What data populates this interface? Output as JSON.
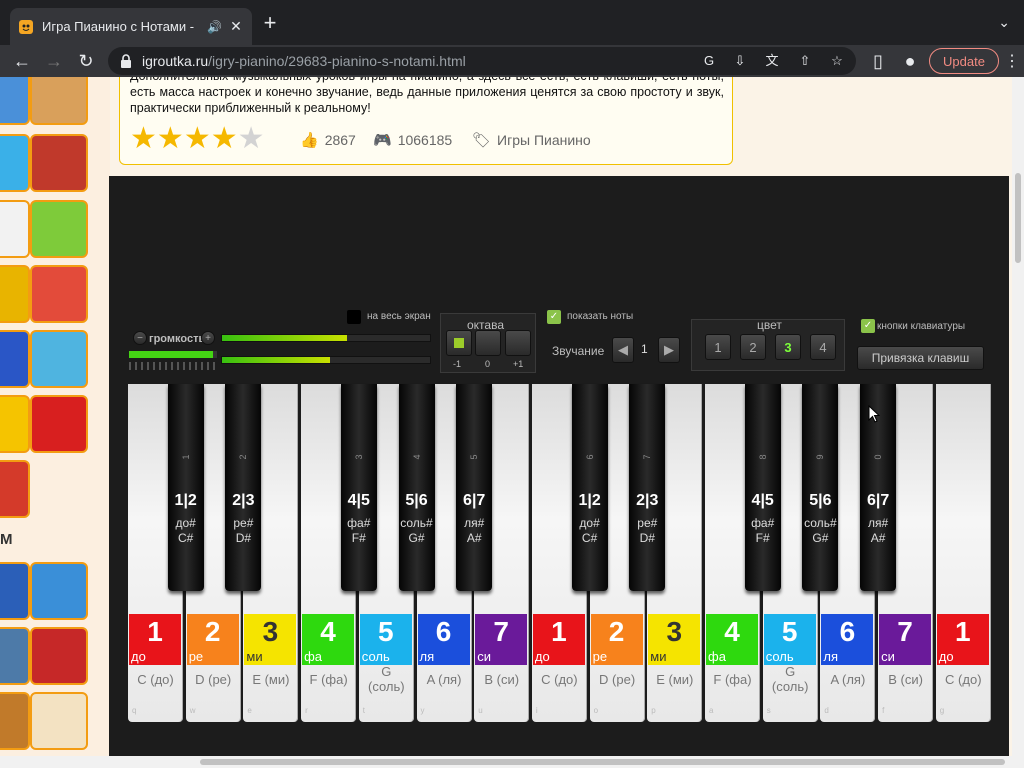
{
  "browser": {
    "tab_title": "Игра Пианино с Нотами -",
    "url_host": "igroutka.ru",
    "url_path": "/igry-pianino/29683-pianino-s-notami.html",
    "update_label": "Update"
  },
  "description": {
    "text": "Дополнительных музыкальных уроков игры на пианино, а здесь все есть, есть клавиши, есть ноты, есть масса настроек и конечно звучание, ведь данные приложения ценятся за свою простоту и звук, практически приближенный к реальному!",
    "rating_stars": 4,
    "rating_max": 5,
    "likes": "2867",
    "plays": "1066185",
    "category": "Игры Пианино"
  },
  "sidebar": {
    "heading": "М"
  },
  "game": {
    "volume_label": "громкость",
    "volume_level": 0.95,
    "meter_top": 0.6,
    "meter_bottom": 0.52,
    "fullscreen_label": "на весь экран",
    "octave_label": "октава",
    "octave_marks": [
      "-1",
      "0",
      "+1"
    ],
    "show_notes_label": "показать ноты",
    "sound_label": "Звучание",
    "sound_value": "1",
    "color_label": "цвет",
    "color_options": [
      "1",
      "2",
      "3",
      "4"
    ],
    "color_selected": "3",
    "keyboard_buttons_label": "кнопки клавиатуры",
    "bind_keys_label": "Привязка клавиш"
  },
  "white_keys": [
    {
      "num": "1",
      "solf": "до",
      "name": "C (до)",
      "kbd": "q",
      "color": "#e8141a"
    },
    {
      "num": "2",
      "solf": "ре",
      "name": "D (ре)",
      "kbd": "w",
      "color": "#f7821c"
    },
    {
      "num": "3",
      "solf": "ми",
      "name": "E (ми)",
      "kbd": "e",
      "color": "#f5e400"
    },
    {
      "num": "4",
      "solf": "фа",
      "name": "F (фа)",
      "kbd": "r",
      "color": "#2ed90e"
    },
    {
      "num": "5",
      "solf": "соль",
      "name": "G (соль)",
      "kbd": "t",
      "color": "#1bb2ec"
    },
    {
      "num": "6",
      "solf": "ля",
      "name": "A (ля)",
      "kbd": "y",
      "color": "#1b4fdc"
    },
    {
      "num": "7",
      "solf": "си",
      "name": "B (си)",
      "kbd": "u",
      "color": "#6a1a9a"
    },
    {
      "num": "1",
      "solf": "до",
      "name": "C (до)",
      "kbd": "i",
      "color": "#e8141a"
    },
    {
      "num": "2",
      "solf": "ре",
      "name": "D (ре)",
      "kbd": "o",
      "color": "#f7821c"
    },
    {
      "num": "3",
      "solf": "ми",
      "name": "E (ми)",
      "kbd": "p",
      "color": "#f5e400"
    },
    {
      "num": "4",
      "solf": "фа",
      "name": "F (фа)",
      "kbd": "a",
      "color": "#2ed90e"
    },
    {
      "num": "5",
      "solf": "соль",
      "name": "G (соль)",
      "kbd": "s",
      "color": "#1bb2ec"
    },
    {
      "num": "6",
      "solf": "ля",
      "name": "A (ля)",
      "kbd": "d",
      "color": "#1b4fdc"
    },
    {
      "num": "7",
      "solf": "си",
      "name": "B (си)",
      "kbd": "f",
      "color": "#6a1a9a"
    },
    {
      "num": "1",
      "solf": "до",
      "name": "C (до)",
      "kbd": "g",
      "color": "#e8141a"
    }
  ],
  "black_keys": [
    {
      "kbd": "1",
      "keys": "1|2",
      "solf": "до#",
      "letter": "C#",
      "after": 0
    },
    {
      "kbd": "2",
      "keys": "2|3",
      "solf": "ре#",
      "letter": "D#",
      "after": 1
    },
    {
      "kbd": "3",
      "keys": "4|5",
      "solf": "фа#",
      "letter": "F#",
      "after": 3
    },
    {
      "kbd": "4",
      "keys": "5|6",
      "solf": "соль#",
      "letter": "G#",
      "after": 4
    },
    {
      "kbd": "5",
      "keys": "6|7",
      "solf": "ля#",
      "letter": "A#",
      "after": 5
    },
    {
      "kbd": "6",
      "keys": "1|2",
      "solf": "до#",
      "letter": "C#",
      "after": 7
    },
    {
      "kbd": "7",
      "keys": "2|3",
      "solf": "ре#",
      "letter": "D#",
      "after": 8
    },
    {
      "kbd": "8",
      "keys": "4|5",
      "solf": "фа#",
      "letter": "F#",
      "after": 10
    },
    {
      "kbd": "9",
      "keys": "5|6",
      "solf": "соль#",
      "letter": "G#",
      "after": 11
    },
    {
      "kbd": "0",
      "keys": "6|7",
      "solf": "ля#",
      "letter": "A#",
      "after": 12
    }
  ]
}
